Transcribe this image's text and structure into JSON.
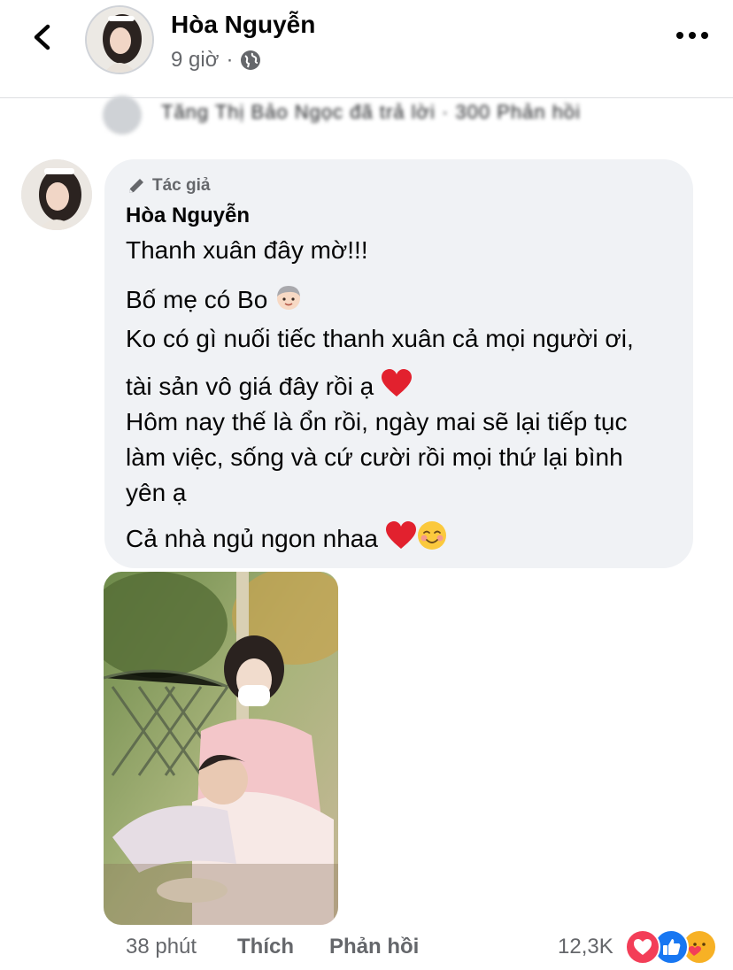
{
  "header": {
    "name": "Hòa Nguyễn",
    "time": "9 giờ",
    "separator": "·",
    "privacy_icon": "globe-icon",
    "menu_icon": "more-horizontal-icon",
    "back_icon": "chevron-left-icon"
  },
  "reply_context": {
    "text": "Tăng Thị Bảo Ngọc đã trả lời · 300 Phản hồi"
  },
  "comment": {
    "badge": "Tác giả",
    "author": "Hòa Nguyễn",
    "lines": [
      "Thanh xuân đây mờ!!!",
      "Bố mẹ có Bo",
      "Ko có gì nuối tiếc thanh xuân cả mọi người ơi,",
      "tài sản vô giá đây rồi ạ",
      "Hôm nay thế là ổn rồi, ngày mai sẽ lại tiếp tục",
      "làm việc, sống và cứ cười rồi mọi thứ lại bình",
      "yên ạ",
      "Cả nhà ngủ ngon nhaa"
    ],
    "emojis": [
      "boy-face-emoji",
      "red-heart-emoji",
      "red-heart-emoji",
      "smiling-face-emoji"
    ]
  },
  "footer": {
    "time": "38 phút",
    "like_label": "Thích",
    "reply_label": "Phản hồi",
    "reaction_count": "12,3K",
    "reactions": [
      "love",
      "like",
      "care"
    ]
  },
  "colors": {
    "bubble": "#f0f2f5",
    "secondary_text": "#65676b",
    "like_blue": "#1877f2",
    "love_red": "#f33e58",
    "care_yellow": "#f7b125"
  }
}
